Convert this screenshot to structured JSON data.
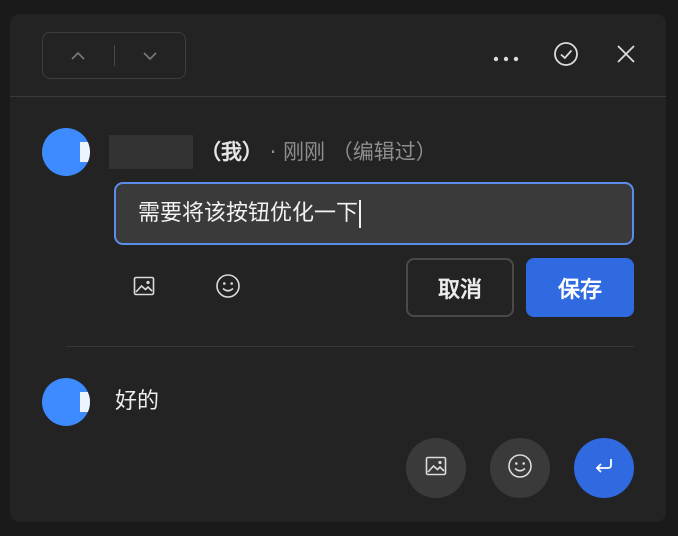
{
  "header": {
    "prev_icon": "chevron-up-icon",
    "next_icon": "chevron-down-icon",
    "more_icon": "more-horizontal-icon",
    "resolve_icon": "check-circle-icon",
    "close_icon": "close-icon"
  },
  "comment": {
    "author_suffix": "（我）",
    "time_text": "· 刚刚",
    "edited_text": "（编辑过）",
    "edit_value": "需要将该按钮优化一下",
    "image_icon": "image-icon",
    "emoji_icon": "emoji-icon",
    "cancel_label": "取消",
    "save_label": "保存"
  },
  "reply": {
    "text": "好的",
    "image_icon": "image-icon",
    "emoji_icon": "emoji-icon",
    "send_icon": "enter-icon"
  },
  "colors": {
    "accent": "#2f6ae0",
    "avatar": "#3d8bff",
    "input_border": "#5b8de8",
    "panel_bg": "#232323"
  }
}
